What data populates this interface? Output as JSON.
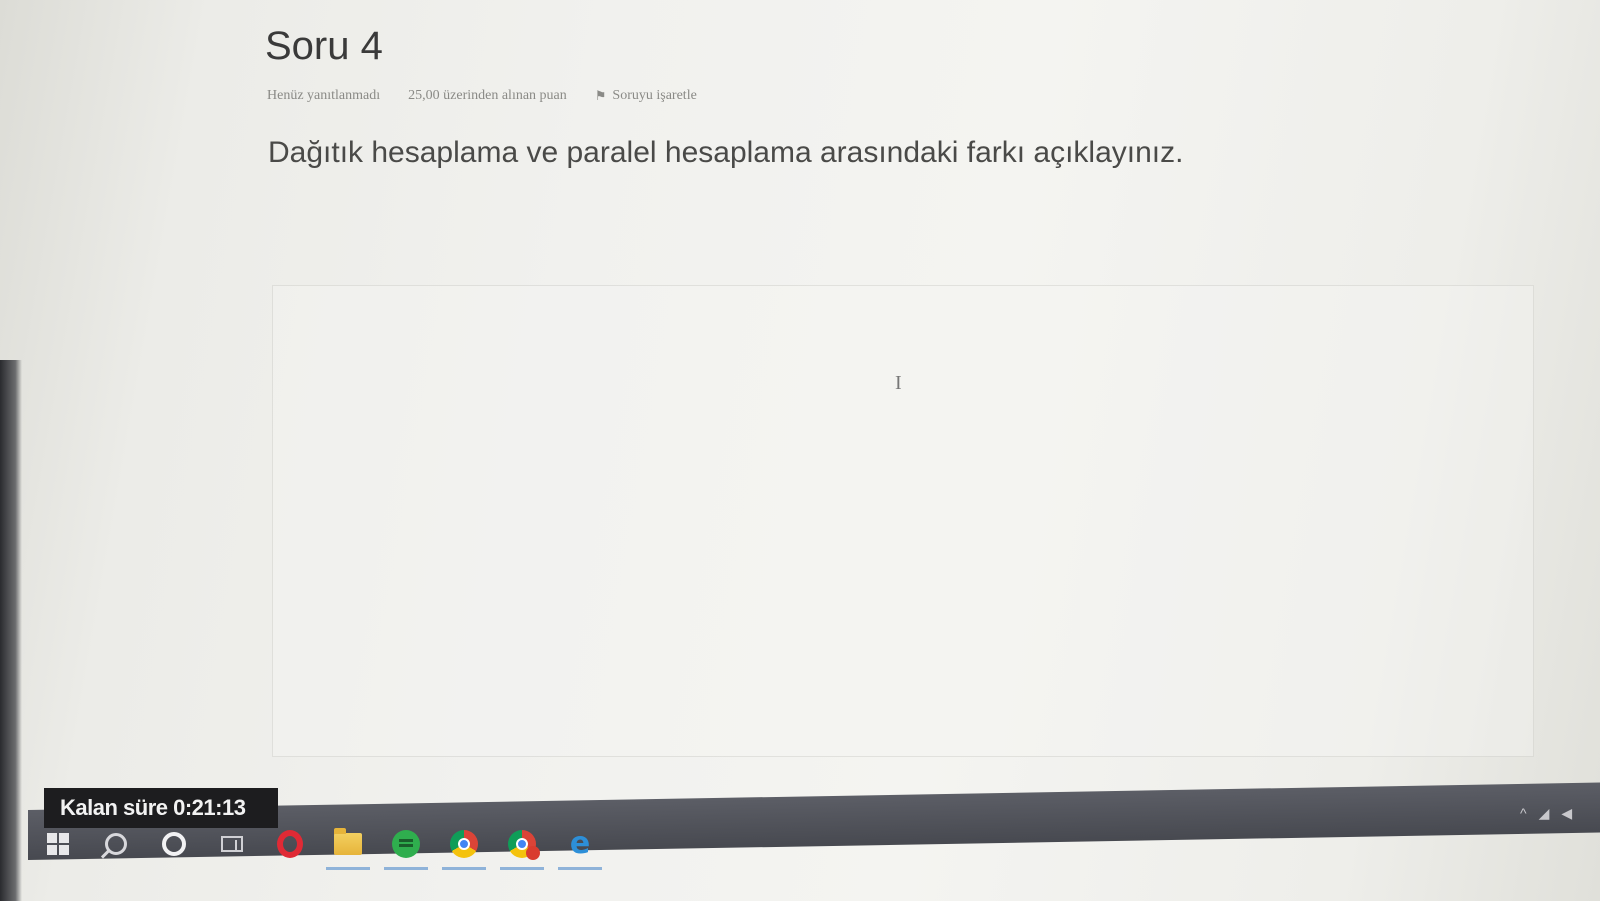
{
  "question": {
    "title": "Soru 4",
    "status": "Henüz yanıtlanmadı",
    "points": "25,00 üzerinden alınan puan",
    "flag_label": "Soruyu işaretle",
    "text": "Dağıtık hesaplama ve paralel hesaplama arasındaki farkı açıklayınız."
  },
  "editor": {
    "cursor_glyph": "I"
  },
  "timer": {
    "label": "Kalan süre 0:21:13"
  },
  "taskbar": {
    "items": [
      {
        "icon": "windows-start-icon"
      },
      {
        "icon": "search-icon"
      },
      {
        "icon": "cortana-icon"
      },
      {
        "icon": "task-view-icon"
      },
      {
        "icon": "opera-browser-icon"
      },
      {
        "icon": "file-explorer-icon"
      },
      {
        "icon": "green-app-icon"
      },
      {
        "icon": "chrome-icon"
      },
      {
        "icon": "chrome-profile-icon"
      },
      {
        "icon": "edge-icon"
      }
    ],
    "edge_glyph": "e",
    "tray_chevron": "^"
  },
  "colors": {
    "background": "#f1f1ee",
    "title_text": "#3a3a3a",
    "taskbar": "#4f5158",
    "timer_bg": "#1d1d1f",
    "opera_red": "#e02a35",
    "edge_blue": "#2d8fd8"
  }
}
